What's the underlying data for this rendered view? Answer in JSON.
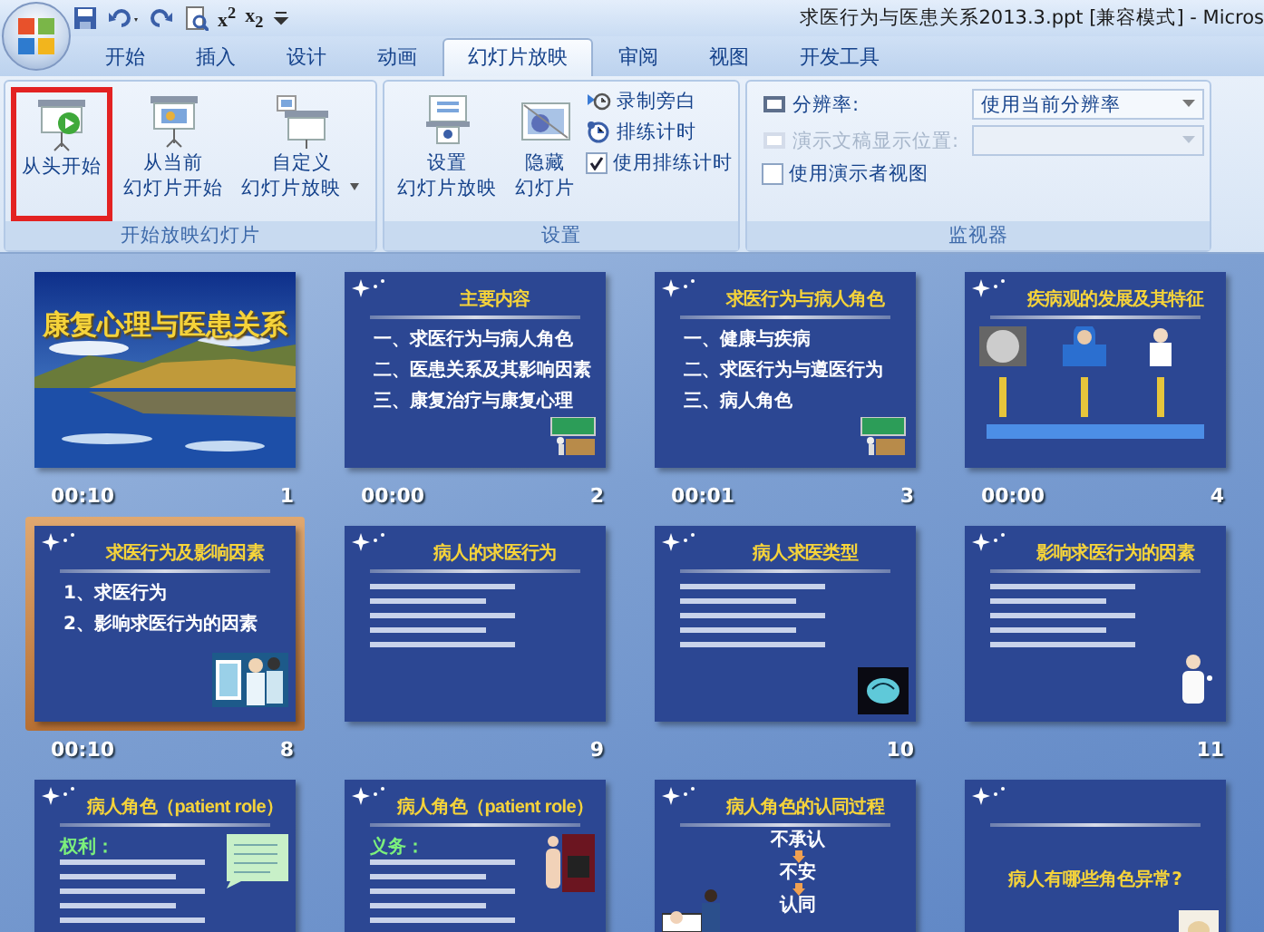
{
  "window": {
    "title": "求医行为与医患关系2013.3.ppt [兼容模式] - Micros"
  },
  "quick_access": [
    {
      "kind": "save"
    },
    {
      "kind": "undo"
    },
    {
      "kind": "redo"
    },
    {
      "kind": "preview"
    },
    {
      "kind": "text",
      "label": "x$^{2}$"
    },
    {
      "kind": "text",
      "label": "x$_{2}$"
    },
    {
      "kind": "customize"
    }
  ],
  "tabs": [
    {
      "label": "开始",
      "selected": false
    },
    {
      "label": "插入",
      "selected": false
    },
    {
      "label": "设计",
      "selected": false
    },
    {
      "label": "动画",
      "selected": false
    },
    {
      "label": "幻灯片放映",
      "selected": true
    },
    {
      "label": "审阅",
      "selected": false
    },
    {
      "label": "视图",
      "selected": false
    },
    {
      "label": "开发工具",
      "selected": false
    }
  ],
  "ribbon": {
    "groups": [
      {
        "label": "开始放映幻灯片",
        "controls": [
          {
            "kind": "large",
            "lines": [
              "从头开始"
            ],
            "highlighted": true
          },
          {
            "kind": "large",
            "lines": [
              "从当前",
              "幻灯片开始"
            ],
            "highlighted": false
          },
          {
            "kind": "large",
            "lines": [
              "自定义",
              "幻灯片放映"
            ],
            "dropdown": true,
            "highlighted": false
          }
        ]
      },
      {
        "label": "设置",
        "controls": [
          {
            "kind": "large",
            "lines": [
              "设置",
              "幻灯片放映"
            ],
            "highlighted": false
          },
          {
            "kind": "large",
            "lines": [
              "隐藏",
              "幻灯片"
            ],
            "highlighted": false
          },
          {
            "kind": "small",
            "label": "录制旁白"
          },
          {
            "kind": "small",
            "label": "排练计时"
          },
          {
            "kind": "check",
            "label": "使用排练计时",
            "checked": true
          }
        ]
      },
      {
        "label": "监视器",
        "controls": [
          {
            "kind": "combo",
            "label": "分辨率:",
            "value": "使用当前分辨率",
            "disabled": false
          },
          {
            "kind": "combo",
            "label": "演示文稿显示位置:",
            "disabled": true
          },
          {
            "kind": "check",
            "label": "使用演示者视图",
            "checked": false
          }
        ]
      }
    ]
  },
  "slides": [
    {
      "number": "1",
      "time": "00:10",
      "title": "康复心理与医患关系",
      "selected": false
    },
    {
      "kind": "content",
      "number": "2",
      "time": "00:00",
      "title": "主要内容",
      "lines": [
        "一、求医行为与病人角色",
        "二、医患关系及其影响因素",
        "三、康复治疗与康复心理"
      ],
      "selected": false
    },
    {
      "kind": "content",
      "number": "3",
      "time": "00:01",
      "title": "求医行为与病人角色",
      "lines": [
        "一、健康与疾病",
        "二、求医行为与遵医行为",
        "三、病人角色"
      ],
      "selected": false
    },
    {
      "kind": "content",
      "number": "4",
      "time": "00:00",
      "title": "疾病观的发展及其特征",
      "selected": false
    },
    {
      "kind": "content",
      "number": "8",
      "time": "00:10",
      "title": "求医行为及影响因素",
      "lines": [
        "1、求医行为",
        "2、影响求医行为的因素"
      ],
      "selected": true
    },
    {
      "kind": "content",
      "number": "9",
      "title": "病人的求医行为",
      "selected": false
    },
    {
      "kind": "content",
      "number": "10",
      "title": "病人求医类型",
      "selected": false
    },
    {
      "kind": "content",
      "number": "11",
      "title": "影响求医行为的因素",
      "selected": false
    },
    {
      "kind": "content",
      "title": "病人角色（patient role）",
      "subhead": "权利：",
      "selected": false
    },
    {
      "kind": "content",
      "title": "病人角色（patient role）",
      "subhead": "义务：",
      "selected": false
    },
    {
      "kind": "flow",
      "title": "病人角色的认同过程",
      "lines": [
        "不承认",
        "不安",
        "认同"
      ],
      "selected": false
    },
    {
      "kind": "message",
      "message": "病人有哪些角色异常?",
      "selected": false
    }
  ]
}
